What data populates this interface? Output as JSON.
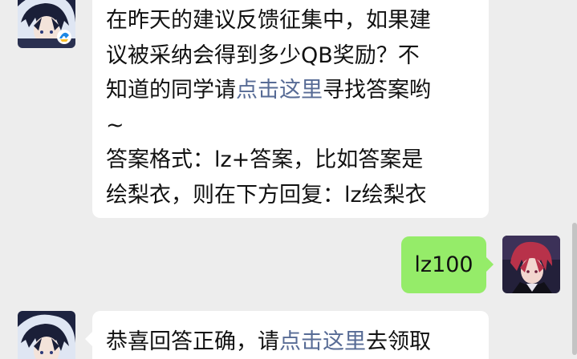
{
  "messages": [
    {
      "sender": "official-account",
      "lines": [
        {
          "text": "在昨天的建议反馈征集中，如果建"
        },
        {
          "text": "议被采纳会得到多少QB奖励？不"
        },
        {
          "pre": "知道的同学请",
          "link": "点击这里",
          "post": "寻找答案哟"
        },
        {
          "text": "~"
        },
        {
          "text": "答案格式：lz+答案，比如答案是"
        },
        {
          "text": "绘梨衣，则在下方回复：lz绘梨衣"
        }
      ]
    },
    {
      "sender": "me",
      "text": "lz100"
    },
    {
      "sender": "official-account",
      "lines": [
        {
          "pre": "恭喜回答正确，请",
          "link": "点击这里",
          "post": "去领取"
        }
      ]
    }
  ],
  "colors": {
    "background": "#ededed",
    "incoming_bubble": "#ffffff",
    "outgoing_bubble": "#95ec69",
    "link": "#576b95",
    "text": "#111111"
  },
  "icons": {
    "official_avatar": "anime-boy-avatar",
    "official_badge": "game-logo-badge",
    "user_avatar": "anime-character-avatar"
  }
}
